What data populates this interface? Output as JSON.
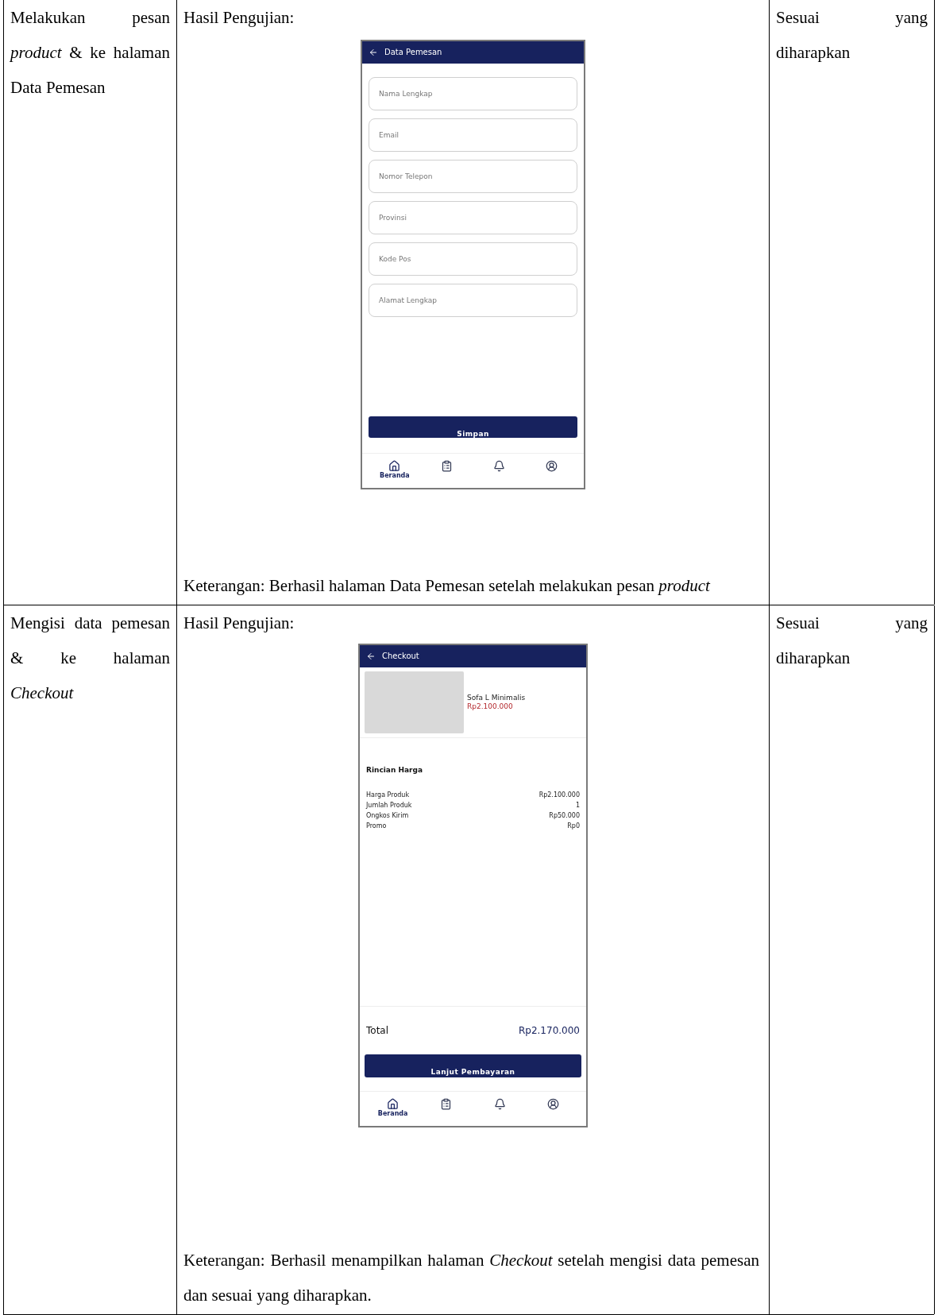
{
  "rows": [
    {
      "scenario": "Melakukan pesan *product* & ke halaman Data Pemesan",
      "result_label": "Hasil Pengujian:",
      "screen": {
        "kind": "form",
        "title": "Data Pemesan",
        "fields": [
          {
            "placeholder": "Nama Lengkap"
          },
          {
            "placeholder": "Email"
          },
          {
            "placeholder": "Nomor Telepon"
          },
          {
            "placeholder": "Provinsi"
          },
          {
            "placeholder": "Kode Pos"
          },
          {
            "placeholder": "Alamat Lengkap"
          }
        ],
        "button": "Simpan",
        "nav": [
          {
            "kind": "home",
            "label": "Beranda",
            "selected": true
          },
          {
            "kind": "orders",
            "selected": false
          },
          {
            "kind": "bell",
            "selected": false
          },
          {
            "kind": "profile",
            "selected": false
          }
        ]
      },
      "note": "Keterangan: Berhasil halaman Data Pemesan setelah melakukan pesan *product*",
      "expected": "Sesuai yang diharapkan"
    },
    {
      "scenario": "Mengisi data pemesan & ke halaman *Checkout*",
      "result_label": "Hasil Pengujian:",
      "screen": {
        "kind": "checkout",
        "title": "Checkout",
        "product": {
          "name": "Sofa L Minimalis",
          "price": "Rp2.100.000"
        },
        "section": "Rincian Harga",
        "lines": [
          {
            "label": "Harga Produk",
            "value": "Rp2.100.000"
          },
          {
            "label": "Jumlah Produk",
            "value": "1"
          },
          {
            "label": "Ongkos Kirim",
            "value": "Rp50.000"
          },
          {
            "label": "Promo",
            "value": "Rp0"
          }
        ],
        "total": {
          "label": "Total",
          "value": "Rp2.170.000"
        },
        "button": "Lanjut Pembayaran",
        "nav": [
          {
            "kind": "home",
            "label": "Beranda",
            "selected": true
          },
          {
            "kind": "orders",
            "selected": false
          },
          {
            "kind": "bell",
            "selected": false
          },
          {
            "kind": "profile",
            "selected": false
          }
        ]
      },
      "note": "Keterangan: Berhasil menampilkan halaman *Checkout* setelah mengisi data pemesan dan sesuai yang diharapkan.",
      "expected": "Sesuai yang diharapkan"
    }
  ]
}
